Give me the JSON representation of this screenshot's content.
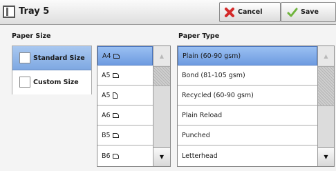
{
  "header": {
    "title": "Tray 5",
    "cancel_label": "Cancel",
    "save_label": "Save"
  },
  "paper_size": {
    "label": "Paper Size",
    "options": [
      "Standard Size",
      "Custom Size"
    ],
    "selected": "Standard Size"
  },
  "size_list": {
    "items": [
      "A4",
      "A5",
      "A5",
      "A6",
      "B5",
      "B6"
    ],
    "orientations": [
      "landscape",
      "landscape",
      "portrait",
      "landscape",
      "landscape",
      "landscape"
    ],
    "selected_index": 0
  },
  "paper_type": {
    "label": "Paper Type",
    "items": [
      "Plain (60-90 gsm)",
      "Bond (81-105 gsm)",
      "Recycled (60-90 gsm)",
      "Plain Reload",
      "Punched",
      "Letterhead"
    ],
    "selected_index": 0
  },
  "colors": {
    "selection_blue": "#7ea8e2",
    "cancel_red": "#d42a2a",
    "save_green": "#6fb43c"
  }
}
